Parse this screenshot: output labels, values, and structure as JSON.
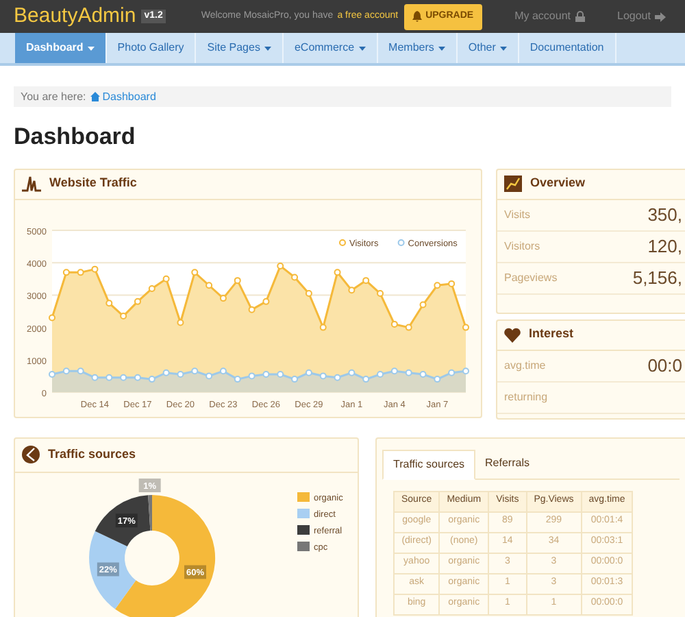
{
  "header": {
    "logo": "BeautyAdmin",
    "version": "v1.2",
    "welcome": "Welcome MosaicPro, you have",
    "account_link": "a free account",
    "upgrade_button": "UPGRADE",
    "my_account": "My account",
    "logout": "Logout"
  },
  "nav": [
    {
      "label": "Dashboard",
      "selected": true,
      "has_menu": true
    },
    {
      "label": "Photo Gallery",
      "selected": false,
      "has_menu": false
    },
    {
      "label": "Site Pages",
      "selected": false,
      "has_menu": true
    },
    {
      "label": "eCommerce",
      "selected": false,
      "has_menu": true
    },
    {
      "label": "Members",
      "selected": false,
      "has_menu": true
    },
    {
      "label": "Other",
      "selected": false,
      "has_menu": true
    },
    {
      "label": "Documentation",
      "selected": false,
      "has_menu": false
    }
  ],
  "breadcrumb": {
    "prefix": "You are here:",
    "link": "Dashboard"
  },
  "page_title": "Dashboard",
  "traffic_panel": {
    "title": "Website Traffic",
    "chart_data": {
      "type": "area",
      "categories": [
        null,
        null,
        null,
        "Dec 14",
        null,
        null,
        "Dec 17",
        null,
        null,
        "Dec 20",
        null,
        null,
        "Dec 23",
        null,
        null,
        "Dec 26",
        null,
        null,
        "Dec 29",
        null,
        null,
        "Jan 1",
        null,
        null,
        "Jan 4",
        null,
        null,
        "Jan 7",
        null,
        null
      ],
      "series": [
        {
          "name": "Visitors",
          "color": "#f5b93a",
          "values": [
            2300,
            3700,
            3700,
            3800,
            2750,
            2350,
            2800,
            3200,
            3500,
            2150,
            3700,
            3300,
            2900,
            3450,
            2550,
            2800,
            3900,
            3550,
            3050,
            2000,
            3700,
            3150,
            3450,
            3050,
            2100,
            2000,
            2700,
            3300,
            3350,
            2000
          ]
        },
        {
          "name": "Conversions",
          "color": "#9cc9ea",
          "values": [
            550,
            650,
            650,
            450,
            450,
            450,
            450,
            400,
            600,
            550,
            650,
            500,
            650,
            400,
            500,
            550,
            550,
            400,
            600,
            500,
            450,
            600,
            400,
            550,
            650,
            600,
            550,
            400,
            600,
            650
          ]
        }
      ],
      "ylim": [
        0,
        5000
      ],
      "yticks": [
        0,
        1000,
        2000,
        3000,
        4000,
        5000
      ],
      "legend": "top-right"
    }
  },
  "overview": {
    "title": "Overview",
    "rows": [
      {
        "label": "Visits",
        "value": "350,"
      },
      {
        "label": "Visitors",
        "value": "120,"
      },
      {
        "label": "Pageviews",
        "value": "5,156,"
      }
    ]
  },
  "interest": {
    "title": "Interest",
    "rows": [
      {
        "label": "avg.time",
        "value": "00:0"
      },
      {
        "label": "returning"
      }
    ]
  },
  "sources_panel": {
    "title": "Traffic sources",
    "chart_data": {
      "type": "donut",
      "categories": [
        "organic",
        "direct",
        "referral",
        "cpc"
      ],
      "values": [
        60,
        22,
        17,
        1
      ],
      "colors": [
        "#f5b93a",
        "#a8cff2",
        "#3d3d3d",
        "#777777"
      ],
      "value_labels": [
        "60%",
        "22%",
        "17%",
        "1%"
      ],
      "legend": "top-right"
    }
  },
  "table_panel": {
    "tabs": [
      {
        "label": "Traffic sources",
        "selected": true
      },
      {
        "label": "Referrals",
        "selected": false
      }
    ],
    "columns": [
      "Source",
      "Medium",
      "Visits",
      "Pg.Views",
      "avg.time"
    ],
    "rows": [
      [
        "google",
        "organic",
        "89",
        "299",
        "00:01:4"
      ],
      [
        "(direct)",
        "(none)",
        "14",
        "34",
        "00:03:1"
      ],
      [
        "yahoo",
        "organic",
        "3",
        "3",
        "00:00:0"
      ],
      [
        "ask",
        "organic",
        "1",
        "3",
        "00:01:3"
      ],
      [
        "bing",
        "organic",
        "1",
        "1",
        "00:00:0"
      ]
    ]
  }
}
